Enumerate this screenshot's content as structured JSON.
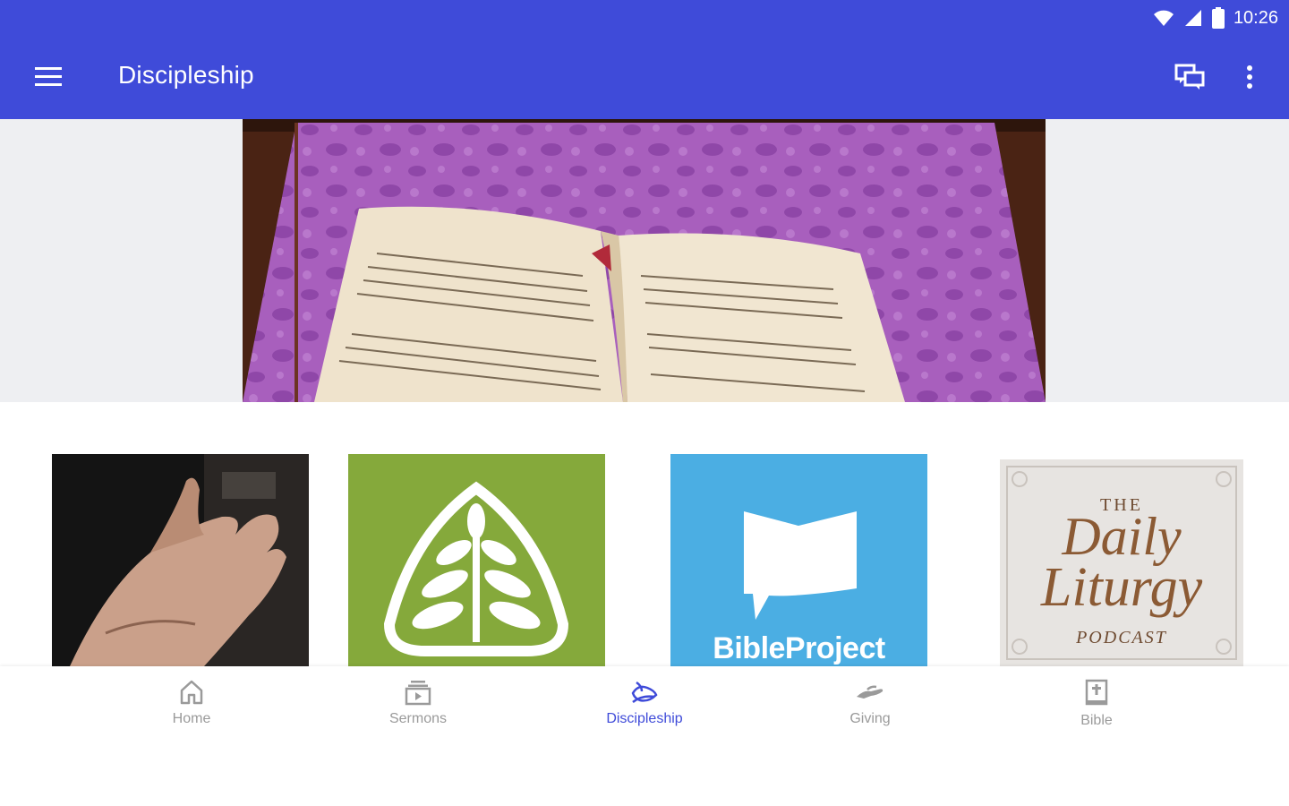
{
  "status_bar": {
    "time": "10:26",
    "icons": [
      "wifi-icon",
      "signal-icon",
      "battery-icon"
    ]
  },
  "app_bar": {
    "title": "Discipleship",
    "background": "#3f4bd9",
    "left_icon": "menu-icon",
    "right_icons": [
      "chat-icon",
      "more-vert-icon"
    ]
  },
  "hero": {
    "image": "open-bible-on-purple-cloth"
  },
  "tiles": [
    {
      "image": "open-hand-photo"
    },
    {
      "image": "ligonier-tree-logo"
    },
    {
      "image": "bibleproject-logo",
      "text": "BibleProject"
    },
    {
      "image": "daily-liturgy-podcast-logo",
      "text": {
        "the": "THE",
        "daily": "Daily",
        "liturgy": "Liturgy",
        "podcast": "PODCAST"
      }
    }
  ],
  "bottom_nav": {
    "active_color": "#3f4bd9",
    "items": [
      {
        "label": "Home",
        "icon": "home-icon"
      },
      {
        "label": "Sermons",
        "icon": "sermons-icon"
      },
      {
        "label": "Discipleship",
        "icon": "discipleship-icon",
        "active": true
      },
      {
        "label": "Giving",
        "icon": "giving-icon"
      },
      {
        "label": "Bible",
        "icon": "bible-icon"
      }
    ]
  }
}
